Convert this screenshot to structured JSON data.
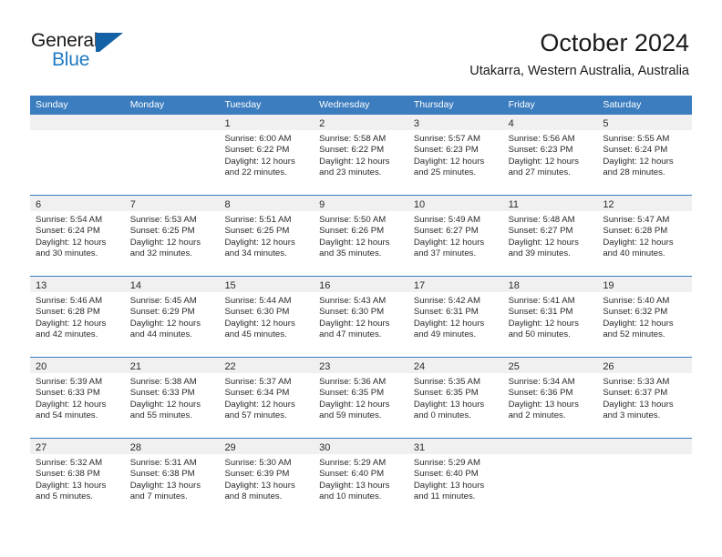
{
  "brand": {
    "name_top": "General",
    "name_bottom": "Blue",
    "logo_icon": "triangle-logo-icon",
    "accent_color": "#1362a6",
    "blue_text_color": "#1f7ac4"
  },
  "header": {
    "title": "October 2024",
    "subtitle": "Utakarra, Western Australia, Australia"
  },
  "theme": {
    "header_row_bg": "#3b7dbf",
    "daynum_strip_bg": "#f0f0f0",
    "grid_line": "#3b7dbf",
    "text": "#2a2a2a"
  },
  "weekdays": [
    "Sunday",
    "Monday",
    "Tuesday",
    "Wednesday",
    "Thursday",
    "Friday",
    "Saturday"
  ],
  "weeks": [
    [
      {
        "day": "",
        "lines": []
      },
      {
        "day": "",
        "lines": []
      },
      {
        "day": "1",
        "lines": [
          "Sunrise: 6:00 AM",
          "Sunset: 6:22 PM",
          "Daylight: 12 hours",
          "and 22 minutes."
        ]
      },
      {
        "day": "2",
        "lines": [
          "Sunrise: 5:58 AM",
          "Sunset: 6:22 PM",
          "Daylight: 12 hours",
          "and 23 minutes."
        ]
      },
      {
        "day": "3",
        "lines": [
          "Sunrise: 5:57 AM",
          "Sunset: 6:23 PM",
          "Daylight: 12 hours",
          "and 25 minutes."
        ]
      },
      {
        "day": "4",
        "lines": [
          "Sunrise: 5:56 AM",
          "Sunset: 6:23 PM",
          "Daylight: 12 hours",
          "and 27 minutes."
        ]
      },
      {
        "day": "5",
        "lines": [
          "Sunrise: 5:55 AM",
          "Sunset: 6:24 PM",
          "Daylight: 12 hours",
          "and 28 minutes."
        ]
      }
    ],
    [
      {
        "day": "6",
        "lines": [
          "Sunrise: 5:54 AM",
          "Sunset: 6:24 PM",
          "Daylight: 12 hours",
          "and 30 minutes."
        ]
      },
      {
        "day": "7",
        "lines": [
          "Sunrise: 5:53 AM",
          "Sunset: 6:25 PM",
          "Daylight: 12 hours",
          "and 32 minutes."
        ]
      },
      {
        "day": "8",
        "lines": [
          "Sunrise: 5:51 AM",
          "Sunset: 6:25 PM",
          "Daylight: 12 hours",
          "and 34 minutes."
        ]
      },
      {
        "day": "9",
        "lines": [
          "Sunrise: 5:50 AM",
          "Sunset: 6:26 PM",
          "Daylight: 12 hours",
          "and 35 minutes."
        ]
      },
      {
        "day": "10",
        "lines": [
          "Sunrise: 5:49 AM",
          "Sunset: 6:27 PM",
          "Daylight: 12 hours",
          "and 37 minutes."
        ]
      },
      {
        "day": "11",
        "lines": [
          "Sunrise: 5:48 AM",
          "Sunset: 6:27 PM",
          "Daylight: 12 hours",
          "and 39 minutes."
        ]
      },
      {
        "day": "12",
        "lines": [
          "Sunrise: 5:47 AM",
          "Sunset: 6:28 PM",
          "Daylight: 12 hours",
          "and 40 minutes."
        ]
      }
    ],
    [
      {
        "day": "13",
        "lines": [
          "Sunrise: 5:46 AM",
          "Sunset: 6:28 PM",
          "Daylight: 12 hours",
          "and 42 minutes."
        ]
      },
      {
        "day": "14",
        "lines": [
          "Sunrise: 5:45 AM",
          "Sunset: 6:29 PM",
          "Daylight: 12 hours",
          "and 44 minutes."
        ]
      },
      {
        "day": "15",
        "lines": [
          "Sunrise: 5:44 AM",
          "Sunset: 6:30 PM",
          "Daylight: 12 hours",
          "and 45 minutes."
        ]
      },
      {
        "day": "16",
        "lines": [
          "Sunrise: 5:43 AM",
          "Sunset: 6:30 PM",
          "Daylight: 12 hours",
          "and 47 minutes."
        ]
      },
      {
        "day": "17",
        "lines": [
          "Sunrise: 5:42 AM",
          "Sunset: 6:31 PM",
          "Daylight: 12 hours",
          "and 49 minutes."
        ]
      },
      {
        "day": "18",
        "lines": [
          "Sunrise: 5:41 AM",
          "Sunset: 6:31 PM",
          "Daylight: 12 hours",
          "and 50 minutes."
        ]
      },
      {
        "day": "19",
        "lines": [
          "Sunrise: 5:40 AM",
          "Sunset: 6:32 PM",
          "Daylight: 12 hours",
          "and 52 minutes."
        ]
      }
    ],
    [
      {
        "day": "20",
        "lines": [
          "Sunrise: 5:39 AM",
          "Sunset: 6:33 PM",
          "Daylight: 12 hours",
          "and 54 minutes."
        ]
      },
      {
        "day": "21",
        "lines": [
          "Sunrise: 5:38 AM",
          "Sunset: 6:33 PM",
          "Daylight: 12 hours",
          "and 55 minutes."
        ]
      },
      {
        "day": "22",
        "lines": [
          "Sunrise: 5:37 AM",
          "Sunset: 6:34 PM",
          "Daylight: 12 hours",
          "and 57 minutes."
        ]
      },
      {
        "day": "23",
        "lines": [
          "Sunrise: 5:36 AM",
          "Sunset: 6:35 PM",
          "Daylight: 12 hours",
          "and 59 minutes."
        ]
      },
      {
        "day": "24",
        "lines": [
          "Sunrise: 5:35 AM",
          "Sunset: 6:35 PM",
          "Daylight: 13 hours",
          "and 0 minutes."
        ]
      },
      {
        "day": "25",
        "lines": [
          "Sunrise: 5:34 AM",
          "Sunset: 6:36 PM",
          "Daylight: 13 hours",
          "and 2 minutes."
        ]
      },
      {
        "day": "26",
        "lines": [
          "Sunrise: 5:33 AM",
          "Sunset: 6:37 PM",
          "Daylight: 13 hours",
          "and 3 minutes."
        ]
      }
    ],
    [
      {
        "day": "27",
        "lines": [
          "Sunrise: 5:32 AM",
          "Sunset: 6:38 PM",
          "Daylight: 13 hours",
          "and 5 minutes."
        ]
      },
      {
        "day": "28",
        "lines": [
          "Sunrise: 5:31 AM",
          "Sunset: 6:38 PM",
          "Daylight: 13 hours",
          "and 7 minutes."
        ]
      },
      {
        "day": "29",
        "lines": [
          "Sunrise: 5:30 AM",
          "Sunset: 6:39 PM",
          "Daylight: 13 hours",
          "and 8 minutes."
        ]
      },
      {
        "day": "30",
        "lines": [
          "Sunrise: 5:29 AM",
          "Sunset: 6:40 PM",
          "Daylight: 13 hours",
          "and 10 minutes."
        ]
      },
      {
        "day": "31",
        "lines": [
          "Sunrise: 5:29 AM",
          "Sunset: 6:40 PM",
          "Daylight: 13 hours",
          "and 11 minutes."
        ]
      },
      {
        "day": "",
        "lines": []
      },
      {
        "day": "",
        "lines": []
      }
    ]
  ]
}
